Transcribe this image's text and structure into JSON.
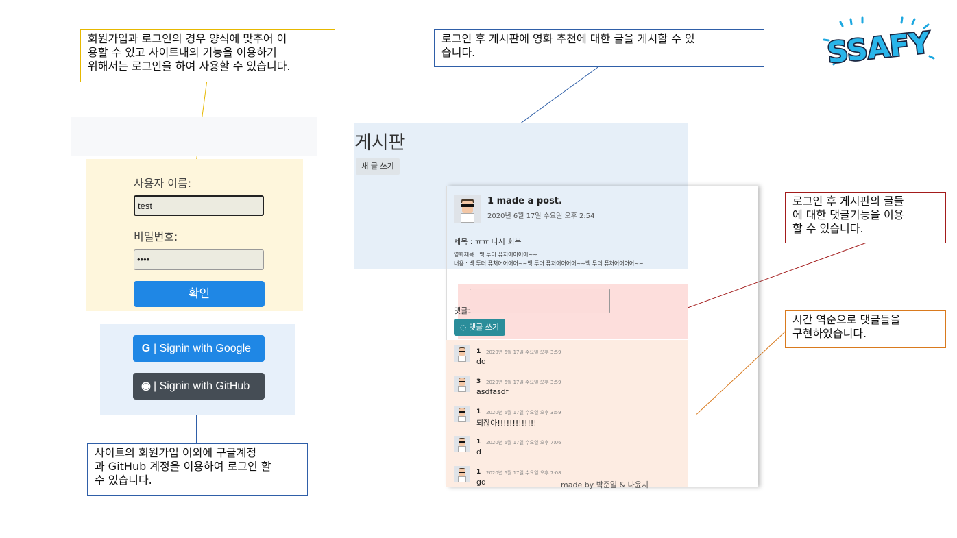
{
  "callouts": {
    "login": [
      "회원가입과 로그인의 경우 양식에 맞추어 이",
      "용할 수 있고 사이트내의 기능을 이용하기",
      "위해서는 로그인을 하여 사용할 수 있습니다."
    ],
    "board": [
      "로그인 후 게시판에 영화 추천에 대한 글을 게시할 수 있",
      "습니다."
    ],
    "comment": [
      "로그인 후 게시판의 글들",
      "에 대한 댓글기능을 이용",
      "할 수 있습니다."
    ],
    "order": [
      "시간 역순으로 댓글들을",
      "구현하였습니다."
    ],
    "oauth": [
      "사이트의 회원가입 이외에 구글계정",
      "과 GitHub 계정을 이용하여 로그인 할",
      "수 있습니다."
    ]
  },
  "login": {
    "username_label": "사용자 이름:",
    "username_value": "test",
    "password_label": "비밀번호:",
    "password_value": "••••",
    "confirm_label": "확인"
  },
  "oauth": {
    "google_label": "| Signin with Google",
    "github_label": "| Signin with GitHub"
  },
  "board": {
    "title": "게시판",
    "new_post_label": "새 글 쓰기",
    "post": {
      "author": "1 made a post.",
      "date": "2020년 6월 17일 수요일 오후 2:54",
      "subject": "제목 : ㅠㅠ 다시 회복",
      "movie": "영화제목 : 백 투더 퓨처어어어어~~",
      "content": "내용 : 백 투더 퓨처어어어어~~백 투더 퓨처어어어어~~백 투더 퓨처어어어어~~"
    },
    "comment_label": "댓글:",
    "comment_button": "댓글 쓰기",
    "comments": [
      {
        "author": "1",
        "date": "2020년 6월 17일 수요일 오후 3:59",
        "text": "dd"
      },
      {
        "author": "3",
        "date": "2020년 6월 17일 수요일 오후 3:59",
        "text": "asdfasdf"
      },
      {
        "author": "1",
        "date": "2020년 6월 17일 수요일 오후 3:59",
        "text": "되잖아!!!!!!!!!!!!!"
      },
      {
        "author": "1",
        "date": "2020년 6월 17일 수요일 오후 7:06",
        "text": "d"
      },
      {
        "author": "1",
        "date": "2020년 6월 17일 수요일 오후 7:08",
        "text": "gd"
      }
    ],
    "footer": "made by 박준일 & 나윤지"
  },
  "logo_text": "SSAFY",
  "colors": {
    "login_border": "#e6b800",
    "board_border": "#2f5fa8",
    "comment_border": "#a31b1b",
    "order_border": "#d97a1e",
    "oauth_border": "#2f5fa8"
  }
}
